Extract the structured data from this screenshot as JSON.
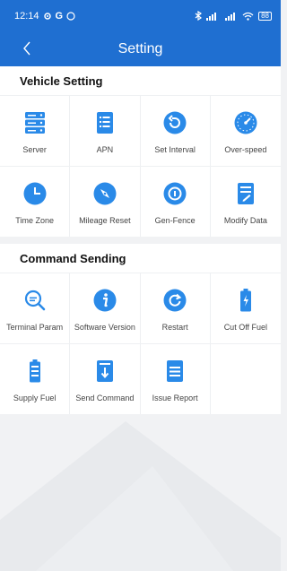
{
  "status": {
    "time": "12:14",
    "left_icons": [
      "settings-icon",
      "google-icon",
      "whatsapp-icon"
    ],
    "battery": "88"
  },
  "nav": {
    "title": "Setting",
    "back_glyph": "<"
  },
  "vehicle_setting": {
    "title": "Vehicle Setting",
    "items": [
      {
        "label": "Server",
        "icon": "server-icon"
      },
      {
        "label": "APN",
        "icon": "document-list-icon"
      },
      {
        "label": "Set Interval",
        "icon": "rotate-back-icon"
      },
      {
        "label": "Over-speed",
        "icon": "speedometer-icon"
      },
      {
        "label": "Time Zone",
        "icon": "clock-icon"
      },
      {
        "label": "Mileage Reset",
        "icon": "compass-icon"
      },
      {
        "label": "Gen-Fence",
        "icon": "geofence-icon"
      },
      {
        "label": "Modify Data",
        "icon": "edit-document-icon"
      }
    ]
  },
  "command_sending": {
    "title": "Command Sending",
    "items": [
      {
        "label": "Terminal Param",
        "icon": "search-icon"
      },
      {
        "label": "Software Version",
        "icon": "info-icon"
      },
      {
        "label": "Restart",
        "icon": "restart-icon"
      },
      {
        "label": "Cut Off Fuel",
        "icon": "battery-charging-icon"
      },
      {
        "label": "Supply Fuel",
        "icon": "battery-icon"
      },
      {
        "label": "Send Command",
        "icon": "download-document-icon"
      },
      {
        "label": "Issue Report",
        "icon": "report-icon"
      }
    ]
  },
  "colors": {
    "primary": "#1f6fd1",
    "icon_blue": "#2a8ae8",
    "background": "#f1f2f4"
  }
}
